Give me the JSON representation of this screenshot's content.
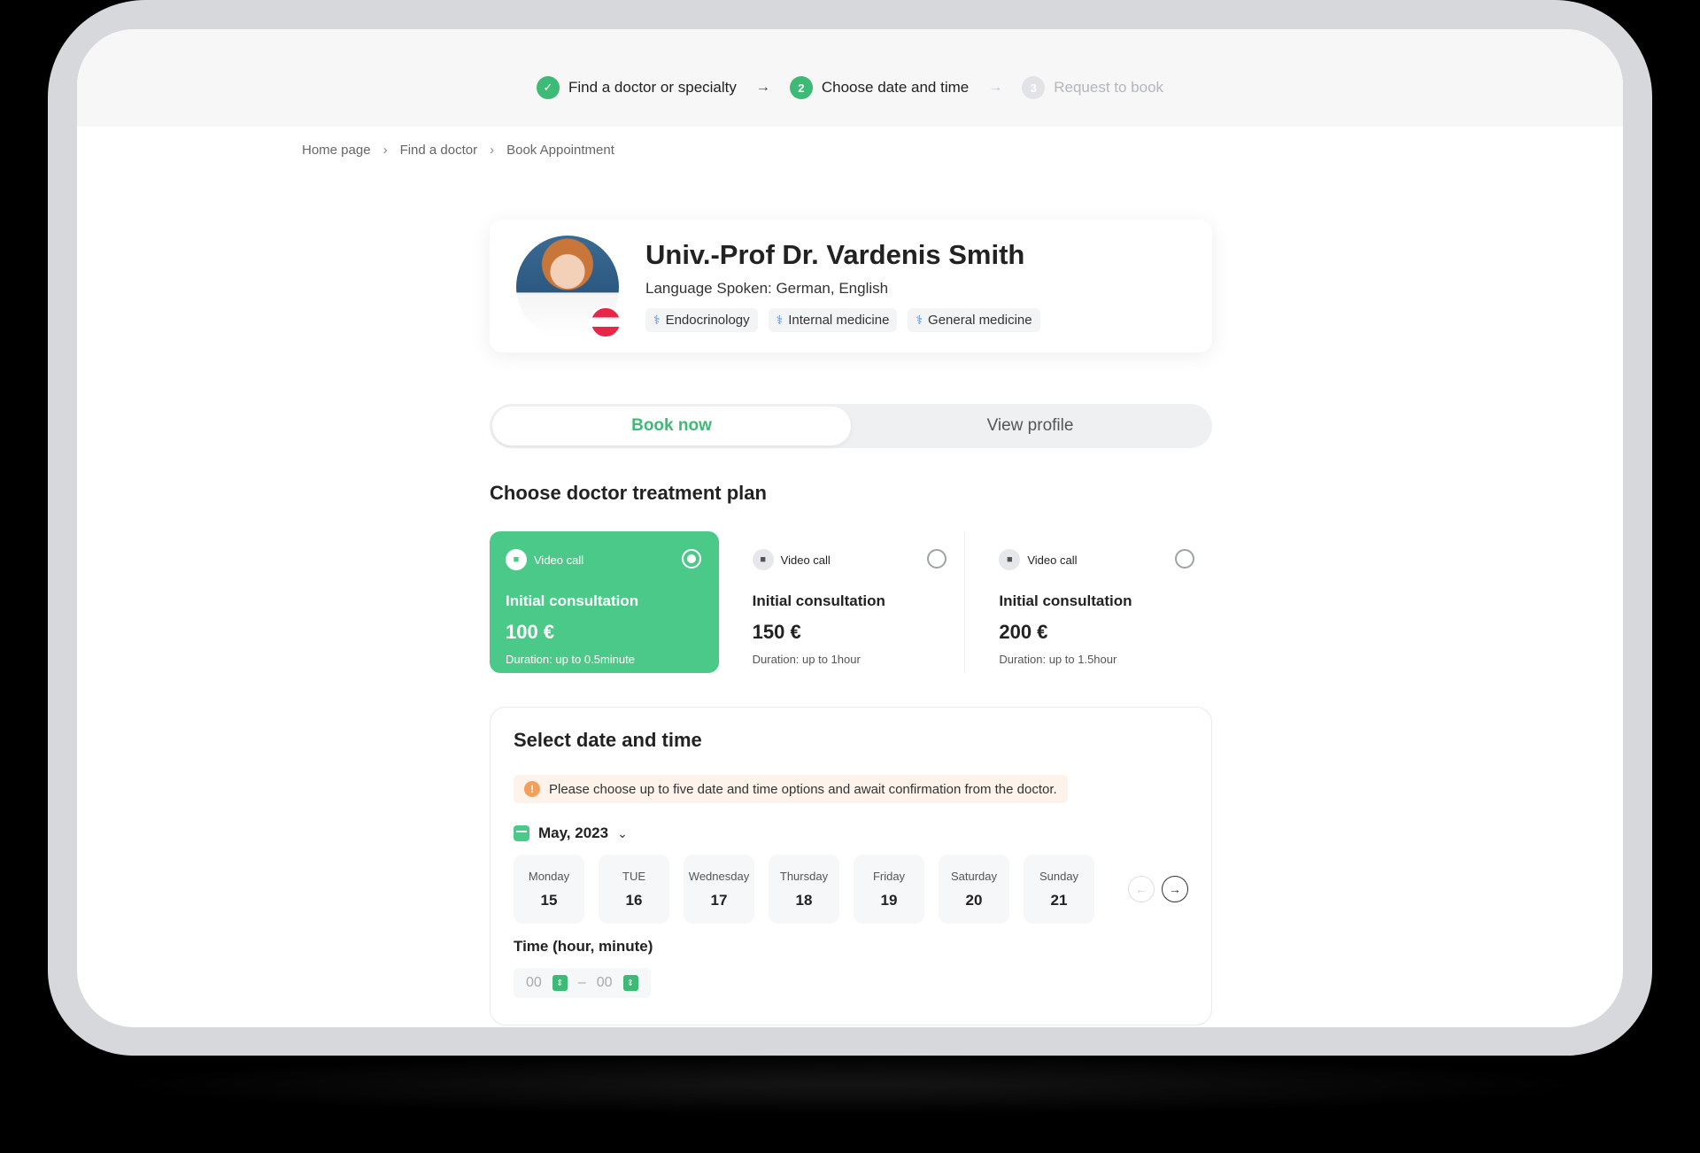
{
  "stepper": {
    "steps": [
      {
        "label": "Find a doctor or specialty",
        "marker": "✓",
        "state": "done"
      },
      {
        "label": "Choose date and time",
        "marker": "2",
        "state": "active"
      },
      {
        "label": "Request to book",
        "marker": "3",
        "state": "pending"
      }
    ]
  },
  "breadcrumb": [
    "Home page",
    "Find a doctor",
    "Book Appointment"
  ],
  "doctor": {
    "name": "Univ.-Prof Dr. Vardenis Smith",
    "language": "Language Spoken: German, English",
    "tags": [
      "Endocrinology",
      "Internal medicine",
      "General medicine"
    ]
  },
  "tabs": {
    "book_now": "Book now",
    "view_profile": "View profile"
  },
  "plans_section": {
    "title": "Choose doctor treatment plan"
  },
  "plans": [
    {
      "type": "Video call",
      "name": "Initial consultation",
      "price": "100 €",
      "duration": "Duration: up to 0.5minute",
      "selected": true
    },
    {
      "type": "Video call",
      "name": "Initial consultation",
      "price": "150 €",
      "duration": "Duration: up to 1hour",
      "selected": false
    },
    {
      "type": "Video call",
      "name": "Initial consultation",
      "price": "200 €",
      "duration": "Duration: up to 1.5hour",
      "selected": false
    }
  ],
  "datetime": {
    "title": "Select date and time",
    "notice": "Please choose up to five date and time options and await confirmation from the doctor.",
    "month": "May, 2023",
    "days": [
      {
        "label": "Monday",
        "num": "15"
      },
      {
        "label": "TUE",
        "num": "16"
      },
      {
        "label": "Wednesday",
        "num": "17"
      },
      {
        "label": "Thursday",
        "num": "18"
      },
      {
        "label": "Friday",
        "num": "19"
      },
      {
        "label": "Saturday",
        "num": "20"
      },
      {
        "label": "Sunday",
        "num": "21"
      }
    ],
    "time_label": "Time (hour, minute)",
    "time_start": "00",
    "time_separator": "–",
    "time_end": "00"
  },
  "colors": {
    "accent": "#3dba76",
    "selected_plan": "#4bc988",
    "notice_bg": "#fdf3ea"
  }
}
